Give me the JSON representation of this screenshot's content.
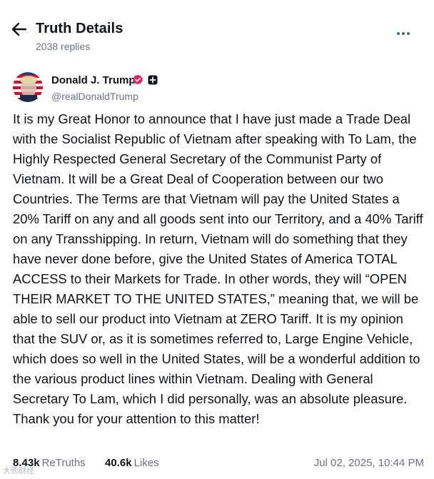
{
  "header": {
    "title": "Truth Details",
    "replies": "2038 replies"
  },
  "author": {
    "name": "Donald J. Trump",
    "handle": "@realDonaldTrump",
    "avatar_icon": "avatar-image",
    "verified_color": "#e0245e"
  },
  "post": {
    "text": "It is my Great Honor to announce that I have just made a Trade Deal with the Socialist Republic of Vietnam after speaking with To Lam, the Highly Respected General Secretary of the Communist Party of Vietnam. It will be a Great Deal of Cooperation between our two Countries. The Terms are that Vietnam will pay the United States a 20% Tariff on any and all goods sent into our Territory, and a 40% Tariff on any Transshipping. In return, Vietnam will do something that they have never done before, give the United States of America TOTAL ACCESS to their Markets for Trade. In other words, they will “OPEN THEIR MARKET TO THE UNITED STATES,” meaning that, we will be able to sell our product into Vietnam at ZERO Tariff. It is my opinion that the SUV or, as it is sometimes referred to, Large Engine Vehicle, which does so well in the United States, will be a wonderful addition to the various product lines within Vietnam. Dealing with General Secretary To Lam, which I did personally, was an absolute pleasure. Thank you for your attention to this matter!"
  },
  "stats": {
    "retruths_count": "8.43k",
    "retruths_label": "ReTruths",
    "likes_count": "40.6k",
    "likes_label": "Likes",
    "timestamp": "Jul 02, 2025, 10:44 PM"
  },
  "watermark": "大熊财经"
}
